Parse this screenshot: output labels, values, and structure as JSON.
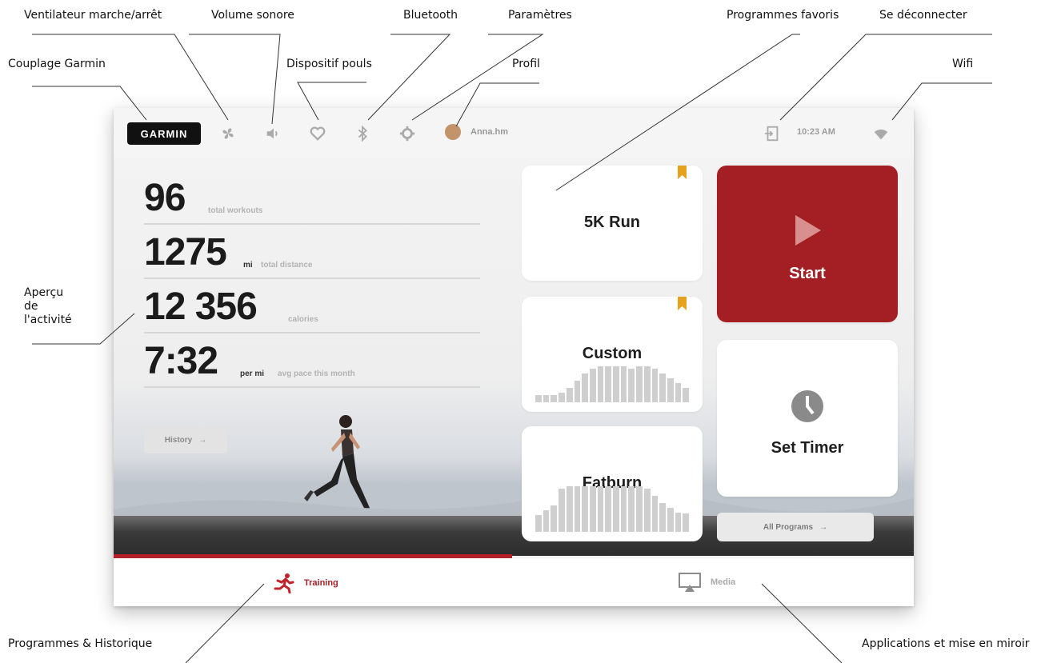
{
  "callouts": {
    "fan": "Ventilateur marche/arrêt",
    "volume": "Volume sonore",
    "bluetooth": "Bluetooth",
    "settings": "Paramètres",
    "favorites": "Programmes favoris",
    "logout": "Se déconnecter",
    "garmin_pairing": "Couplage Garmin",
    "heart_rate": "Dispositif pouls",
    "profile": "Profil",
    "wifi": "Wifi",
    "activity_overview": [
      "Aperçu",
      "de",
      "l'activité"
    ],
    "programs_history": "Programmes & Historique",
    "apps_mirroring": "Applications et mise en miroir"
  },
  "topbar": {
    "logo": "GARMIN",
    "profile_name": "Anna.hm",
    "time": "10:23 AM",
    "icons": [
      "fan-icon",
      "volume-icon",
      "heart-icon",
      "bluetooth-icon",
      "gear-icon",
      "logout-icon",
      "wifi-icon"
    ]
  },
  "stats": [
    {
      "value": "96",
      "unit": "",
      "label": "total workouts"
    },
    {
      "value": "1275",
      "unit": "mi",
      "label": "total distance"
    },
    {
      "value": "12 356",
      "unit": "",
      "label": "calories"
    },
    {
      "value": "7:32",
      "unit": "per mi",
      "label": "avg pace this month"
    }
  ],
  "history_button": "History",
  "programs": [
    {
      "name": "5K Run",
      "favorite": true,
      "profile": []
    },
    {
      "name": "Custom",
      "favorite": true,
      "profile": [
        0.15,
        0.15,
        0.15,
        0.2,
        0.3,
        0.45,
        0.6,
        0.7,
        0.75,
        0.75,
        0.75,
        0.75,
        0.7,
        0.75,
        0.75,
        0.7,
        0.6,
        0.5,
        0.4,
        0.3
      ]
    },
    {
      "name": "Fatburn",
      "favorite": false,
      "profile": [
        0.35,
        0.45,
        0.55,
        0.9,
        0.95,
        0.95,
        0.95,
        0.95,
        0.95,
        0.95,
        0.95,
        0.95,
        0.95,
        0.95,
        0.9,
        0.75,
        0.6,
        0.5,
        0.4,
        0.38
      ]
    }
  ],
  "start_label": "Start",
  "timer_label": "Set Timer",
  "all_programs_label": "All Programs",
  "nav": {
    "training": "Training",
    "media": "Media"
  },
  "colors": {
    "accent": "#a41f24",
    "bookmark": "#e6a11d"
  }
}
